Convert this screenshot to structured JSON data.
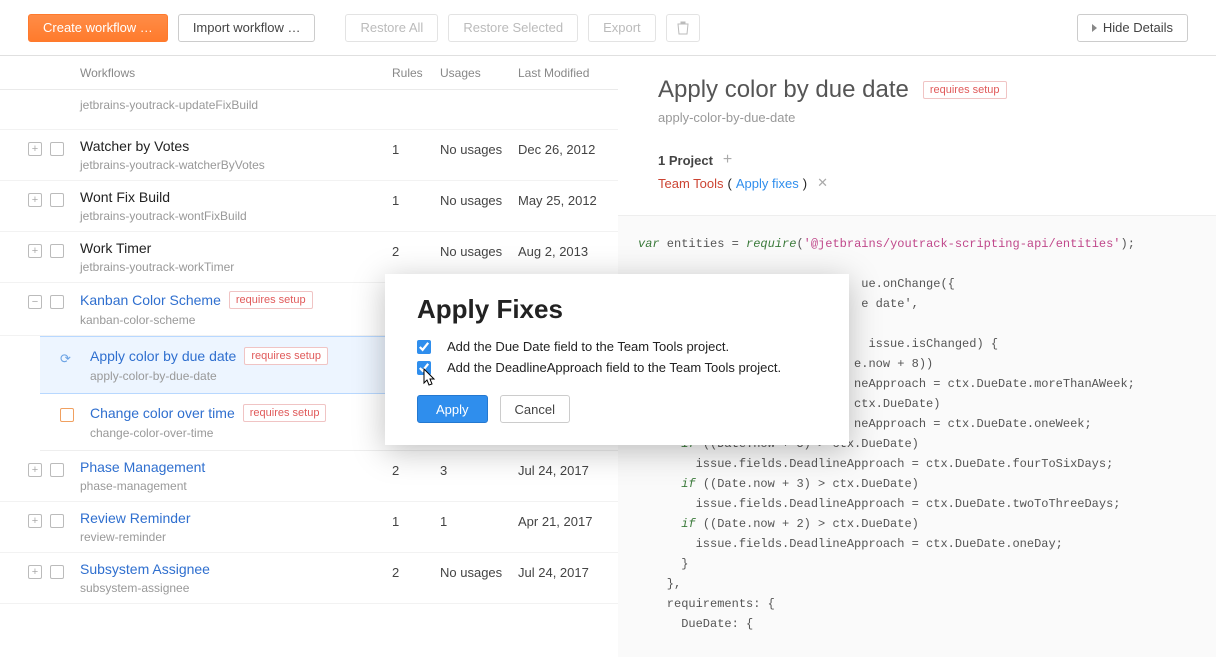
{
  "toolbar": {
    "create": "Create workflow …",
    "import": "Import workflow …",
    "restore_all": "Restore All",
    "restore_sel": "Restore Selected",
    "export": "Export",
    "hide": "Hide Details"
  },
  "headers": {
    "workflows": "Workflows",
    "rules": "Rules",
    "usages": "Usages",
    "modified": "Last Modified"
  },
  "rows": [
    {
      "title": "",
      "id": "jetbrains-youtrack-updateFixBuild",
      "rules": "",
      "usages": "",
      "mod": "",
      "short": true,
      "link": false
    },
    {
      "title": "Watcher by Votes",
      "id": "jetbrains-youtrack-watcherByVotes",
      "rules": "1",
      "usages": "No usages",
      "mod": "Dec 26, 2012",
      "link": false
    },
    {
      "title": "Wont Fix Build",
      "id": "jetbrains-youtrack-wontFixBuild",
      "rules": "1",
      "usages": "No usages",
      "mod": "May 25, 2012",
      "link": false
    },
    {
      "title": "Work Timer",
      "id": "jetbrains-youtrack-workTimer",
      "rules": "2",
      "usages": "No usages",
      "mod": "Aug 2, 2013",
      "link": false
    },
    {
      "title": "Kanban Color Scheme",
      "id": "kanban-color-scheme",
      "rules": "",
      "usages": "",
      "mod": "",
      "link": true,
      "badge": "requires setup",
      "expanded": true
    }
  ],
  "subrows": [
    {
      "title": "Apply color by due date",
      "id": "apply-color-by-due-date",
      "badge": "requires setup",
      "selected": true
    },
    {
      "title": "Change color over time",
      "id": "change-color-over-time",
      "badge": "requires setup",
      "selected": false
    }
  ],
  "rows2": [
    {
      "title": "Phase Management",
      "id": "phase-management",
      "rules": "2",
      "usages": "3",
      "mod": "Jul 24, 2017"
    },
    {
      "title": "Review Reminder",
      "id": "review-reminder",
      "rules": "1",
      "usages": "1",
      "mod": "Apr 21, 2017"
    },
    {
      "title": "Subsystem Assignee",
      "id": "subsystem-assignee",
      "rules": "2",
      "usages": "No usages",
      "mod": "Jul 24, 2017"
    }
  ],
  "detail": {
    "title": "Apply color by due date",
    "badge": "requires setup",
    "id": "apply-color-by-due-date",
    "project_count": "1 Project",
    "project_name": "Team Tools",
    "project_action": "Apply fixes",
    "paren_open": "(",
    "paren_close": ")"
  },
  "code": "var entities = require('@jetbrains/youtrack-scripting-api/entities');\n\n                               ue.onChange({\n                               e date',\n\n                                issue.isChanged) {\n                              e.now + 8))\n                              neApproach = ctx.DueDate.moreThanAWeek;\n                              ctx.DueDate)\n                              neApproach = ctx.DueDate.oneWeek;\n      if ((Date.now + 5) > ctx.DueDate)\n        issue.fields.DeadlineApproach = ctx.DueDate.fourToSixDays;\n      if ((Date.now + 3) > ctx.DueDate)\n        issue.fields.DeadlineApproach = ctx.DueDate.twoToThreeDays;\n      if ((Date.now + 2) > ctx.DueDate)\n        issue.fields.DeadlineApproach = ctx.DueDate.oneDay;\n      }\n    },\n    requirements: {\n      DueDate: {",
  "modal": {
    "title": "Apply Fixes",
    "fix1": "Add the Due Date field to the Team Tools project.",
    "fix2": "Add the DeadlineApproach field to the Team Tools project.",
    "apply": "Apply",
    "cancel": "Cancel"
  }
}
